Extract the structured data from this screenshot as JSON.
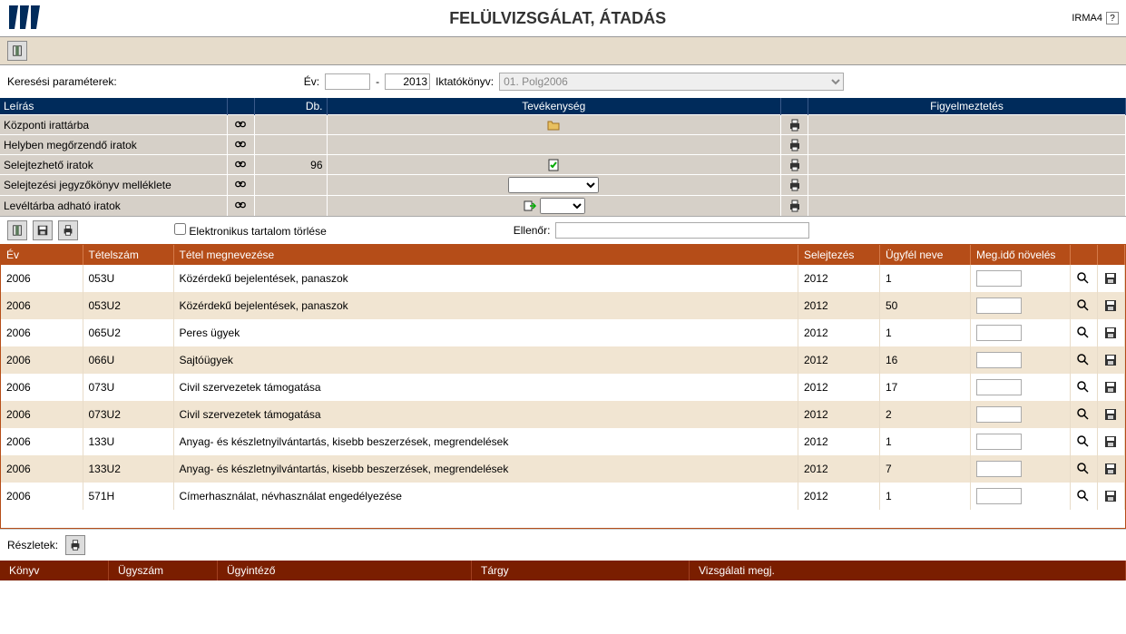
{
  "app": {
    "title": "FELÜLVIZSGÁLAT, ÁTADÁS",
    "brand": "IRMA4",
    "help": "?"
  },
  "search": {
    "label": "Keresési paraméterek:",
    "year_label": "Év:",
    "year_from": "",
    "dash": "-",
    "year_to": "2013",
    "book_label": "Iktatókönyv:",
    "book_value": "01. Polg2006"
  },
  "grid1": {
    "headers": {
      "leiras": "Leírás",
      "db": "Db.",
      "tevek": "Tevékenység",
      "figy": "Figyelmeztetés"
    },
    "rows": [
      {
        "leiras": "Központi irattárba",
        "db": "",
        "has_folder": true
      },
      {
        "leiras": "Helyben megőrzendő iratok",
        "db": ""
      },
      {
        "leiras": "Selejtezhető iratok",
        "db": "96",
        "has_check": true
      },
      {
        "leiras": "Selejtezési jegyzőkönyv melléklete",
        "db": "",
        "has_select": true
      },
      {
        "leiras": "Levéltárba adható iratok",
        "db": "",
        "has_select2": true
      }
    ]
  },
  "toolbar2": {
    "delete_label": "Elektronikus tartalom törlése",
    "ellenor_label": "Ellenőr:",
    "ellenor_value": ""
  },
  "grid2": {
    "headers": {
      "ev": "Év",
      "tetel": "Tételszám",
      "megnev": "Tétel megnevezése",
      "selejt": "Selejtezés",
      "ugyfel": "Ügyfél neve",
      "megido": "Meg.idő növelés"
    },
    "rows": [
      {
        "ev": "2006",
        "tetel": "053U",
        "megnev": "Közérdekű bejelentések, panaszok",
        "selejt": "2012",
        "ugyfel": "1"
      },
      {
        "ev": "2006",
        "tetel": "053U2",
        "megnev": "Közérdekű bejelentések, panaszok",
        "selejt": "2012",
        "ugyfel": "50"
      },
      {
        "ev": "2006",
        "tetel": "065U2",
        "megnev": "Peres ügyek",
        "selejt": "2012",
        "ugyfel": "1"
      },
      {
        "ev": "2006",
        "tetel": "066U",
        "megnev": "Sajtóügyek",
        "selejt": "2012",
        "ugyfel": "16"
      },
      {
        "ev": "2006",
        "tetel": "073U",
        "megnev": "Civil szervezetek támogatása",
        "selejt": "2012",
        "ugyfel": "17"
      },
      {
        "ev": "2006",
        "tetel": "073U2",
        "megnev": "Civil szervezetek támogatása",
        "selejt": "2012",
        "ugyfel": "2"
      },
      {
        "ev": "2006",
        "tetel": "133U",
        "megnev": "Anyag- és készletnyilvántartás, kisebb beszerzések, megrendelések",
        "selejt": "2012",
        "ugyfel": "1"
      },
      {
        "ev": "2006",
        "tetel": "133U2",
        "megnev": "Anyag- és készletnyilvántartás, kisebb beszerzések, megrendelések",
        "selejt": "2012",
        "ugyfel": "7"
      },
      {
        "ev": "2006",
        "tetel": "571H",
        "megnev": "Címerhasználat, névhasználat engedélyezése",
        "selejt": "2012",
        "ugyfel": "1"
      }
    ]
  },
  "details": {
    "label": "Részletek:"
  },
  "footer": {
    "tabs": [
      "Könyv",
      "Ügyszám",
      "Ügyintéző",
      "Tárgy",
      "Vizsgálati megj."
    ]
  }
}
